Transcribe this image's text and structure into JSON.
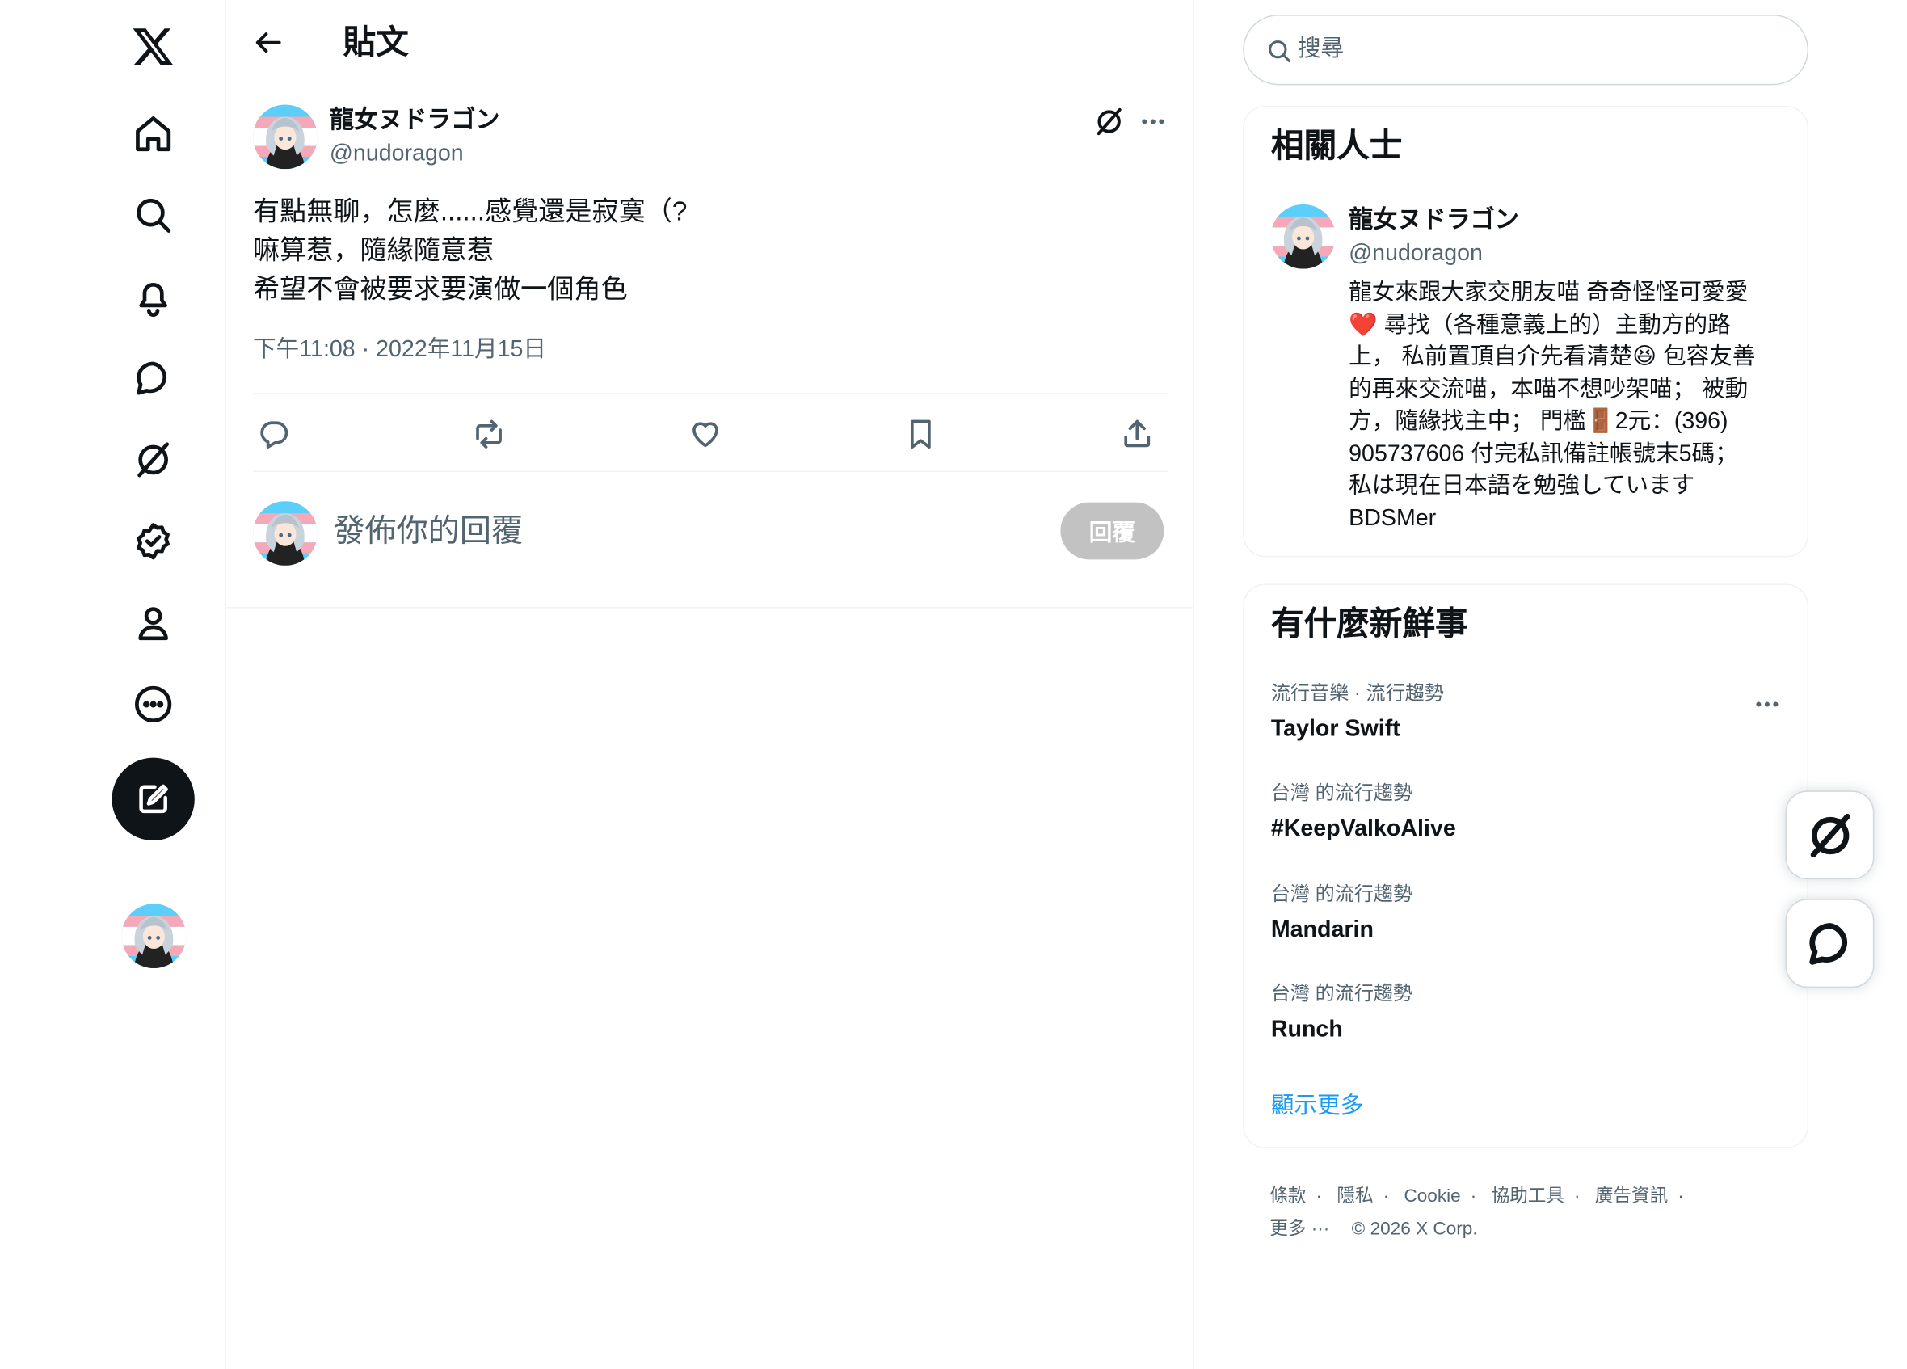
{
  "header": {
    "title": "貼文"
  },
  "post": {
    "display_name": "龍女ヌドラゴン",
    "handle": "@nudoragon",
    "lines": [
      "有點無聊，怎麼......感覺還是寂寞（?",
      "嘛算惹，隨緣隨意惹",
      "希望不會被要求要演做一個角色"
    ],
    "timestamp": "下午11:08 · 2022年11月15日"
  },
  "reply": {
    "placeholder": "發佈你的回覆",
    "button_label": "回覆"
  },
  "search": {
    "placeholder": "搜尋"
  },
  "relevant": {
    "title": "相關人士",
    "display_name": "龍女ヌドラゴン",
    "handle": "@nudoragon",
    "bio": {
      "l1": "龍女來跟大家交朋友喵 奇奇怪怪可愛愛",
      "l2_heart": "❤️",
      "l2": " 尋找（各種意義上的）主動方的路",
      "l3a": "上， 私前置頂自介先看清楚",
      "l3_emoji": "😆",
      "l3b": " 包容友善",
      "l4": "的再來交流喵，本喵不想吵架喵； 被動",
      "l5a": "方，隨緣找主中； 門檻",
      "l5_emoji": "🚪",
      "l5b": "2元：(396)",
      "l6": "905737606 付完私訊備註帳號末5碼；",
      "l7": "私は現在日本語を勉強しています",
      "l8": "BDSMer"
    }
  },
  "trends": {
    "title": "有什麼新鮮事",
    "items": [
      {
        "meta": "流行音樂 · 流行趨勢",
        "name": "Taylor Swift"
      },
      {
        "meta": "台灣 的流行趨勢",
        "name": "#KeepValkoAlive"
      },
      {
        "meta": "台灣 的流行趨勢",
        "name": "Mandarin"
      },
      {
        "meta": "台灣 的流行趨勢",
        "name": "Runch"
      }
    ],
    "show_more": "顯示更多"
  },
  "footer": {
    "links": [
      "條款",
      "隱私",
      "Cookie",
      "協助工具",
      "廣告資訊"
    ],
    "more": "更多 ···",
    "copyright": "© 2026 X Corp."
  },
  "icons": {
    "nav": [
      "x-logo-icon",
      "home-icon",
      "search-icon",
      "bell-icon",
      "message-icon",
      "grok-icon",
      "verified-icon",
      "profile-icon",
      "more-circle-icon",
      "compose-icon"
    ],
    "accent": "#1d9bf0",
    "text_primary": "#0f1419",
    "text_secondary": "#536471"
  }
}
